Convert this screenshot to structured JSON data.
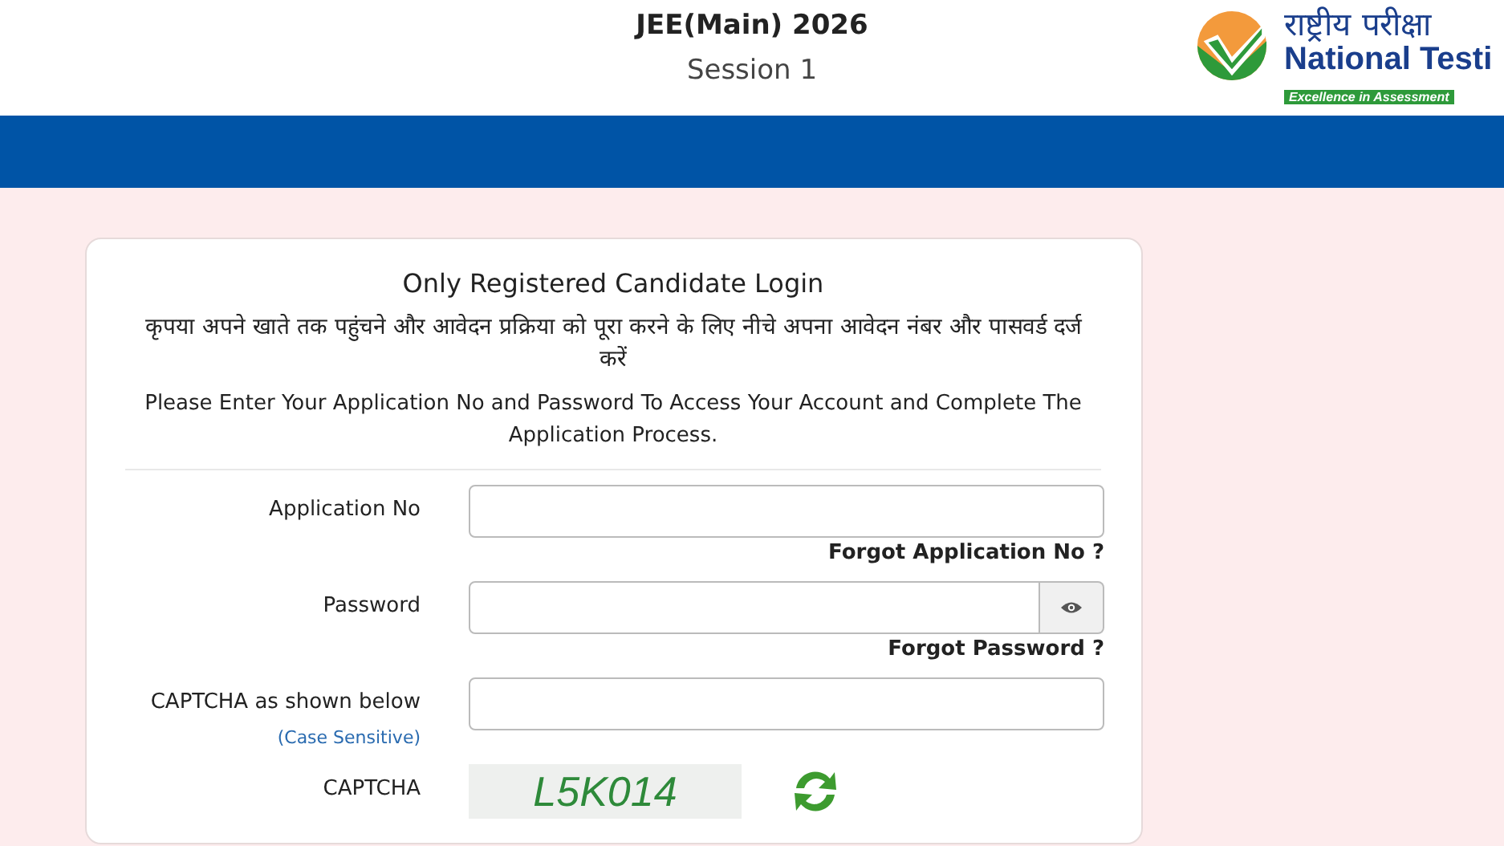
{
  "header": {
    "title": "JEE(Main) 2026",
    "subtitle": "Session 1",
    "logo": {
      "hindi": "राष्ट्रीय परीक्षा",
      "english": "National Testi",
      "tagline": "Excellence in Assessment"
    }
  },
  "login": {
    "title": "Only Registered Candidate Login",
    "hindi_instruction": "कृपया अपने खाते तक पहुंचने और आवेदन प्रक्रिया को पूरा करने के लिए नीचे अपना आवेदन नंबर और पासवर्ड दर्ज करें",
    "instruction": "Please Enter Your Application No and Password To Access Your Account and Complete The Application Process.",
    "fields": [
      {
        "kind": "text",
        "label": "Application No",
        "link": "Forgot Application No ?"
      },
      {
        "kind": "password",
        "label": "Password",
        "link": "Forgot Password ?"
      },
      {
        "kind": "text",
        "label": "CAPTCHA as shown below",
        "note": "(Case Sensitive)"
      },
      {
        "kind": "captcha",
        "label": "CAPTCHA",
        "captcha": "L5K014"
      }
    ]
  }
}
